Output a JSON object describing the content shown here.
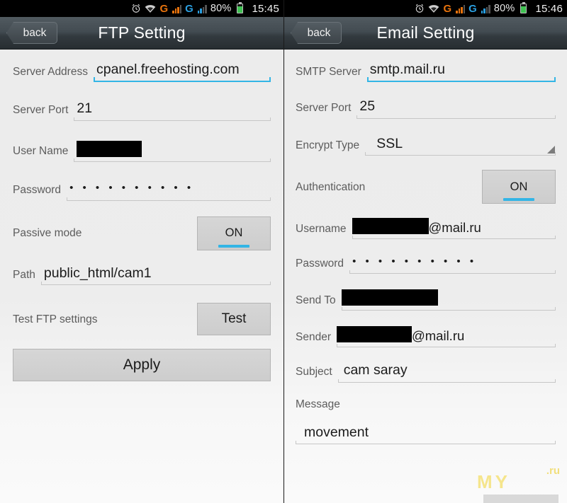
{
  "left_phone": {
    "statusbar": {
      "icons": [
        "alarm-icon",
        "wifi-icon",
        "signal-g-orange-icon",
        "signal-g-blue-icon"
      ],
      "battery_percent": "80%",
      "time": "15:45"
    },
    "titlebar": {
      "back_label": "back",
      "title": "FTP Setting"
    },
    "fields": {
      "server_address_label": "Server Address",
      "server_address_value": "cpanel.freehosting.com",
      "server_port_label": "Server Port",
      "server_port_value": "21",
      "user_name_label": "User Name",
      "user_name_value": "",
      "password_label": "Password",
      "password_value": "• • • • • • • • • •",
      "passive_mode_label": "Passive mode",
      "passive_mode_state": "ON",
      "path_label": "Path",
      "path_value": "public_html/cam1",
      "test_ftp_label": "Test FTP settings",
      "test_button_label": "Test",
      "apply_button_label": "Apply"
    }
  },
  "right_phone": {
    "statusbar": {
      "icons": [
        "alarm-icon",
        "wifi-icon",
        "signal-g-orange-icon",
        "signal-g-blue-icon"
      ],
      "battery_percent": "80%",
      "time": "15:46"
    },
    "titlebar": {
      "back_label": "back",
      "title": "Email Setting"
    },
    "fields": {
      "smtp_server_label": "SMTP Server",
      "smtp_server_value": "smtp.mail.ru",
      "server_port_label": "Server Port",
      "server_port_value": "25",
      "encrypt_type_label": "Encrypt Type",
      "encrypt_type_value": "SSL",
      "authentication_label": "Authentication",
      "authentication_state": "ON",
      "username_label": "Username",
      "username_domain": "@mail.ru",
      "password_label": "Password",
      "password_value": "• • • • • • • • • •",
      "send_to_label": "Send To",
      "send_to_value": "",
      "sender_label": "Sender",
      "sender_domain": "@mail.ru",
      "subject_label": "Subject",
      "subject_value": "cam saray",
      "message_label": "Message",
      "message_value": "movement"
    }
  },
  "watermark": {
    "primary": "MY",
    "secondary": ".ru"
  },
  "colors": {
    "accent": "#33b5e5",
    "titlebar_dark": "#272d31",
    "background": "#ececec",
    "battery_green": "#3fc252"
  }
}
